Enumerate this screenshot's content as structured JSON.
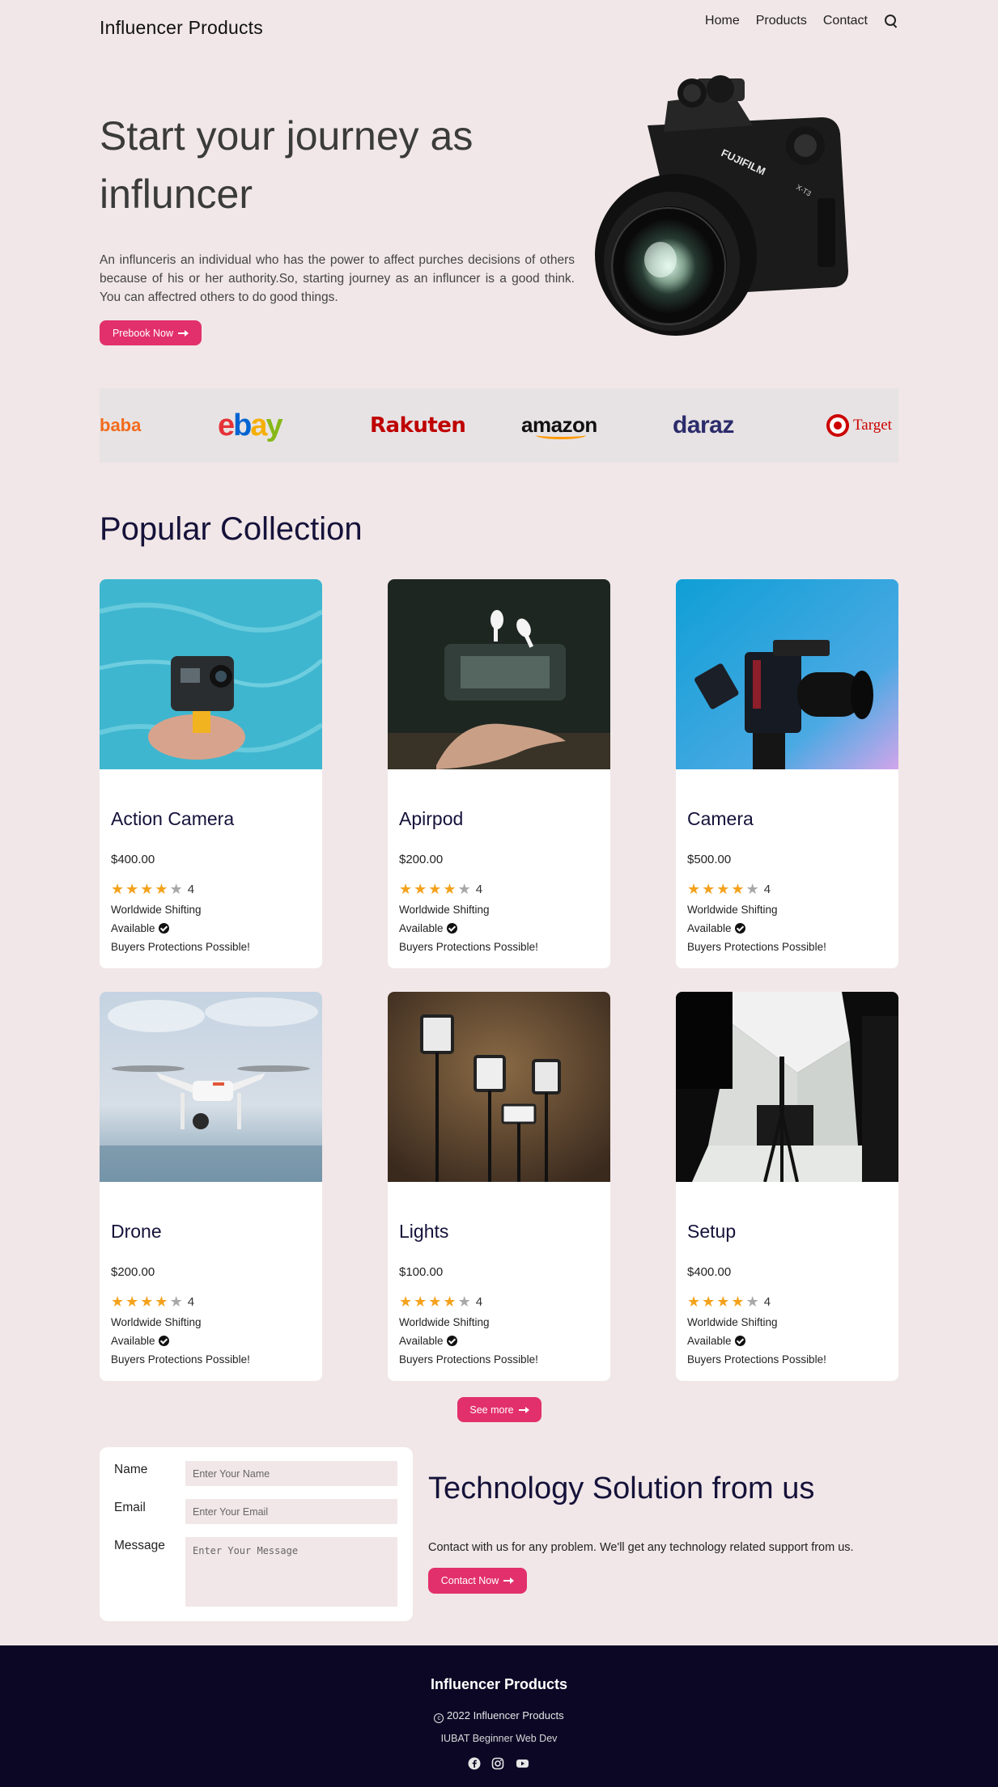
{
  "header": {
    "brand": "Influencer Products",
    "nav": [
      "Home",
      "Products",
      "Contact"
    ]
  },
  "hero": {
    "title": "Start your journey as influncer",
    "text": "An influnceris an individual who has the power to affect purches decisions of others because of his or her authority.So, starting journey as an influncer is a good think. You can affectred others to do good things.",
    "button": "Prebook Now",
    "camera_brand": "FUJIFILM",
    "camera_model": "X-T3"
  },
  "brands": {
    "alibaba": "baba",
    "ebay": [
      "e",
      "b",
      "a",
      "y"
    ],
    "rakuten": "Rakuten",
    "amazon": "amazon",
    "daraz": "daraz",
    "target": "Target"
  },
  "popular": {
    "title": "Popular Collection",
    "feature_shipping": "Worldwide Shifting",
    "feature_available": "Available",
    "feature_protection": "Buyers Protections Possible!",
    "products": [
      {
        "name": "Action Camera",
        "price": "$400.00",
        "rating": 4
      },
      {
        "name": "Apirpod",
        "price": "$200.00",
        "rating": 4
      },
      {
        "name": "Camera",
        "price": "$500.00",
        "rating": 4
      },
      {
        "name": "Drone",
        "price": "$200.00",
        "rating": 4
      },
      {
        "name": "Lights",
        "price": "$100.00",
        "rating": 4
      },
      {
        "name": "Setup",
        "price": "$400.00",
        "rating": 4
      }
    ],
    "see_more": "See more"
  },
  "contact": {
    "name_label": "Name",
    "name_placeholder": "Enter Your Name",
    "email_label": "Email",
    "email_placeholder": "Enter Your Email",
    "message_label": "Message",
    "message_placeholder": "Enter Your Message",
    "title": "Technology Solution from us",
    "text": "Contact with us for any problem. We'll get any technology related support from us.",
    "button": "Contact Now"
  },
  "footer": {
    "brand": "Influencer Products",
    "copyright": "2022 Influencer Products",
    "org": "IUBAT Beginner Web Dev"
  },
  "colors": {
    "background": "#f1e7e8",
    "accent": "#e2306c",
    "heading": "#15123a",
    "footer": "#0b0725",
    "star": "#f4a21d"
  }
}
